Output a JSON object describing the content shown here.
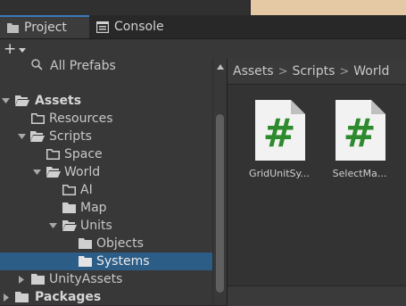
{
  "tabs": [
    {
      "label": "Project",
      "icon": "folder-icon",
      "active": true
    },
    {
      "label": "Console",
      "icon": "console-icon",
      "active": false
    }
  ],
  "toolbar": {
    "create_label": "+",
    "create_icon": "plus-icon"
  },
  "tree": {
    "all_prefabs": "All Prefabs",
    "items": [
      {
        "label": "Assets",
        "bold": true,
        "expanded": true
      },
      {
        "label": "Resources"
      },
      {
        "label": "Scripts",
        "expanded": true
      },
      {
        "label": "Space"
      },
      {
        "label": "World",
        "expanded": true
      },
      {
        "label": "AI"
      },
      {
        "label": "Map"
      },
      {
        "label": "Units",
        "expanded": true
      },
      {
        "label": "Objects"
      },
      {
        "label": "Systems",
        "selected": true
      },
      {
        "label": "UnityAssets",
        "collapsed": true
      },
      {
        "label": "Packages",
        "bold": true,
        "collapsed": true
      }
    ]
  },
  "breadcrumb": [
    "Assets",
    "Scripts",
    "World"
  ],
  "assets": [
    {
      "name": "GridUnitSy...",
      "icon": "csharp-script-icon",
      "glyph": "#"
    },
    {
      "name": "SelectMa...",
      "icon": "csharp-script-icon",
      "glyph": "#"
    }
  ],
  "colors": {
    "accent": "#3a79bb",
    "selection": "#2c5d87",
    "script_hash": "#2d8a2d"
  }
}
